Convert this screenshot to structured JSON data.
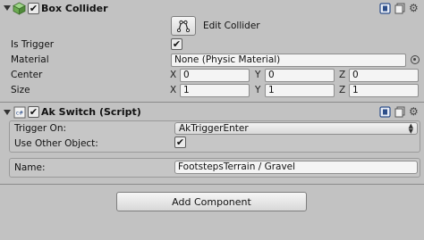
{
  "box_collider": {
    "title": "Box Collider",
    "edit_collider_label": "Edit Collider",
    "is_trigger_label": "Is Trigger",
    "material_label": "Material",
    "material_value": "None (Physic Material)",
    "center_label": "Center",
    "size_label": "Size",
    "axis_x": "X",
    "axis_y": "Y",
    "axis_z": "Z",
    "center": {
      "x": "0",
      "y": "0",
      "z": "0"
    },
    "size": {
      "x": "1",
      "y": "1",
      "z": "1"
    }
  },
  "ak_switch": {
    "title": "Ak Switch (Script)",
    "trigger_on_label": "Trigger On:",
    "trigger_on_value": "AkTriggerEnter",
    "use_other_object_label": "Use Other Object:",
    "name_label": "Name:",
    "name_value": "FootstepsTerrain / Gravel"
  },
  "add_component_label": "Add Component"
}
